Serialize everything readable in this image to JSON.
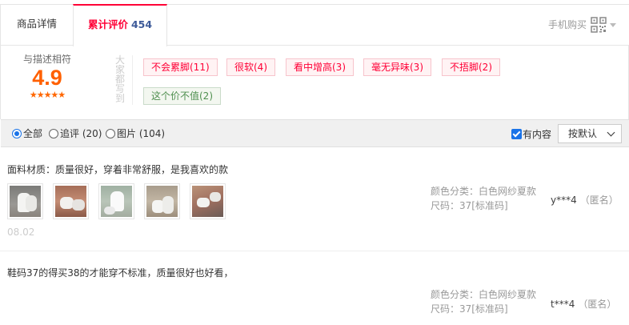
{
  "tabs": {
    "desc_label": "商品详情",
    "review_label": "累计评价",
    "review_count": "454",
    "mobile_buy": "手机购买"
  },
  "summary": {
    "title": "与描述相符",
    "score": "4.9",
    "stars": "★★★★★",
    "vertical_label": "大家都写到",
    "tags": [
      {
        "text": "不会累脚(11)",
        "type": "positive"
      },
      {
        "text": "很软(4)",
        "type": "positive"
      },
      {
        "text": "看中增高(3)",
        "type": "positive"
      },
      {
        "text": "毫无异味(3)",
        "type": "positive"
      },
      {
        "text": "不捂脚(2)",
        "type": "positive"
      },
      {
        "text": "这个价不值(2)",
        "type": "neutral"
      }
    ]
  },
  "filter": {
    "all": "全部",
    "append": "追评 (20)",
    "pics": "图片 (104)",
    "has_content": "有内容",
    "sort": "按默认"
  },
  "reviews": [
    {
      "content": "面料材质：质量很好，穿着非常舒服，是我喜欢的款",
      "photo_count": 5,
      "date": "08.02",
      "color_label": "颜色分类：",
      "color_value": "白色网纱夏款",
      "size_label": "尺码：",
      "size_value": "37[标准码]",
      "user": "y***4",
      "anon": "（匿名）"
    },
    {
      "content": "鞋码37的得买38的才能穿不标准，质量很好也好看，",
      "color_label": "颜色分类：",
      "color_value": "白色网纱夏款",
      "size_label": "尺码：",
      "size_value": "37[标准码]",
      "user": "t***4",
      "anon": "（匿名）"
    }
  ],
  "colors": {
    "accent_red": "#ff0036",
    "score_orange": "#ff6000",
    "link_blue": "#3d5a99"
  }
}
